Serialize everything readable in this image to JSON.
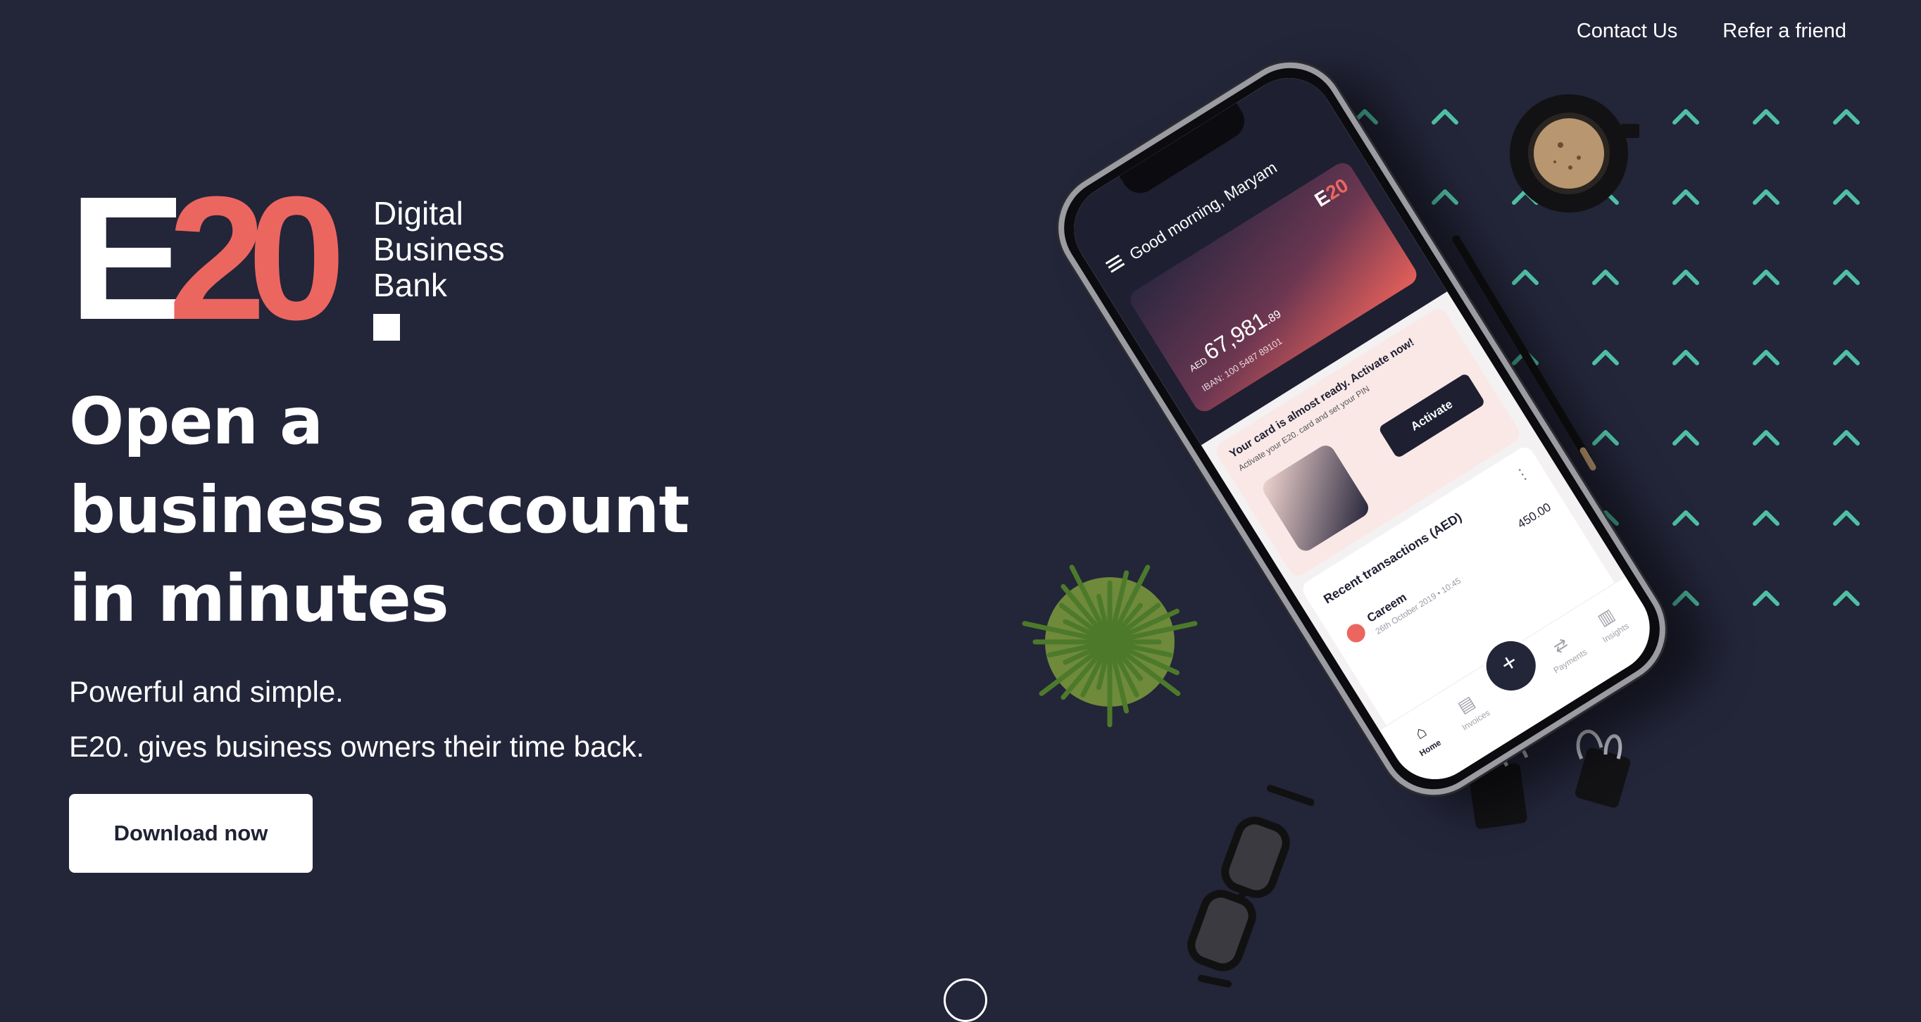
{
  "nav": {
    "contact": "Contact Us",
    "refer": "Refer a friend"
  },
  "logo": {
    "letter": "E",
    "number": "20",
    "tagline": [
      "Digital",
      "Business",
      "Bank"
    ]
  },
  "hero": {
    "title_lines": [
      "Open a",
      "business account",
      "in minutes"
    ],
    "subtitle_lines": [
      "Powerful and simple.",
      "E20. gives business owners their time back."
    ],
    "cta": "Download now"
  },
  "phone": {
    "greeting": "Good morning, Maryam",
    "card": {
      "logo_letter": "E",
      "logo_number": "20",
      "currency": "AED",
      "balance_main": "67,981",
      "balance_cents": ".89",
      "iban": "IBAN: 100 5487 89101"
    },
    "activate": {
      "title": "Your card is almost ready. Activate now!",
      "desc": "Activate your E20. card and set your PIN",
      "button": "Activate"
    },
    "transactions": {
      "title": "Recent transactions (AED)",
      "items": [
        {
          "name": "Careem",
          "date": "26th October 2019 • 10:45",
          "amount": "450.00"
        }
      ]
    },
    "tabs": {
      "home": "Home",
      "invoices": "Invoices",
      "payments": "Payments",
      "insights": "Insights"
    }
  },
  "colors": {
    "background": "#232539",
    "brand": "#ec6660",
    "accent": "#4fc0a4"
  }
}
